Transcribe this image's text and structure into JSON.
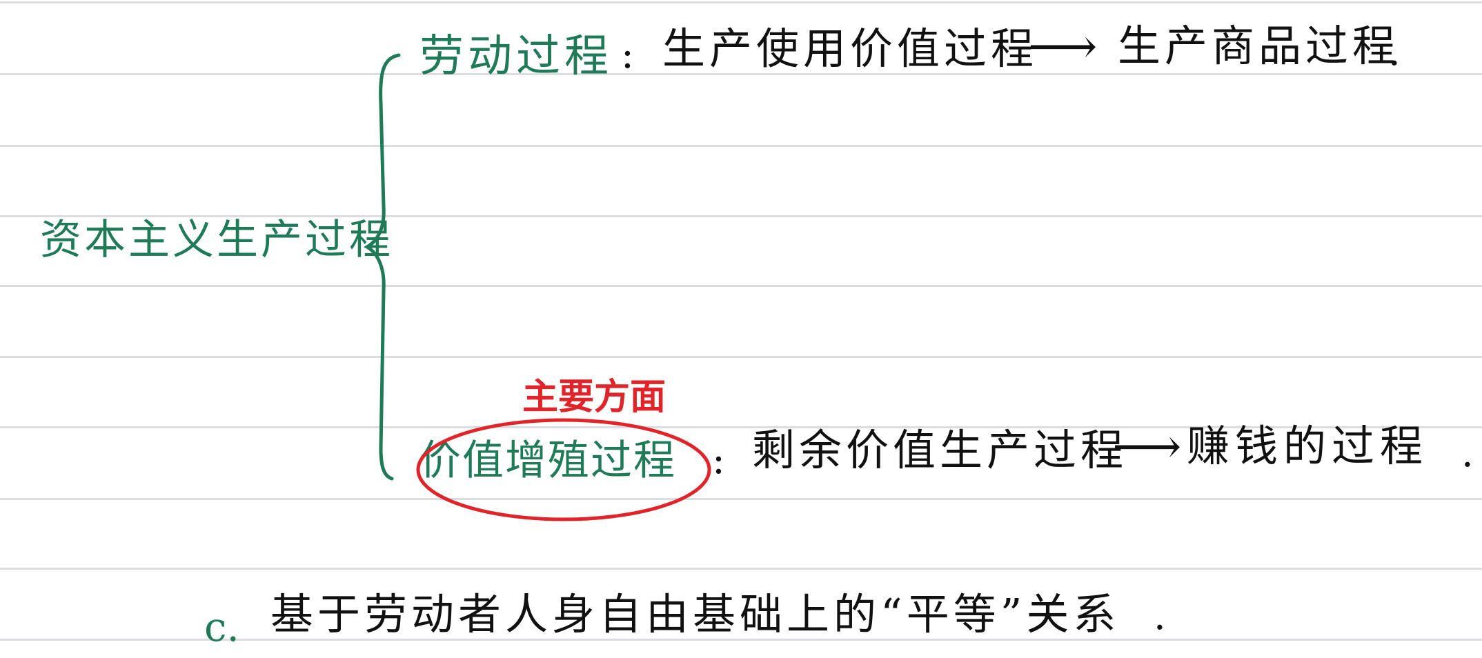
{
  "colors": {
    "green": "#1e7a57",
    "red": "#e02429",
    "ink": "#111111"
  },
  "note": {
    "root": "资本主义生产过程",
    "branch_top": {
      "label": "劳动过程",
      "separator": ":",
      "definition": "生产使用价值过程",
      "arrow": "⟶",
      "result": "生产商品过程",
      "end": "."
    },
    "annotation": "主要方面",
    "branch_bottom": {
      "label": "价值增殖过程",
      "separator": ":",
      "definition": "剩余价值生产过程",
      "arrow": "⟶",
      "result": "赚钱的过程",
      "end": "."
    },
    "item_c": {
      "prefix": "c.",
      "text": "基于劳动者人身自由基础上的“平等”关系",
      "end": "."
    }
  }
}
